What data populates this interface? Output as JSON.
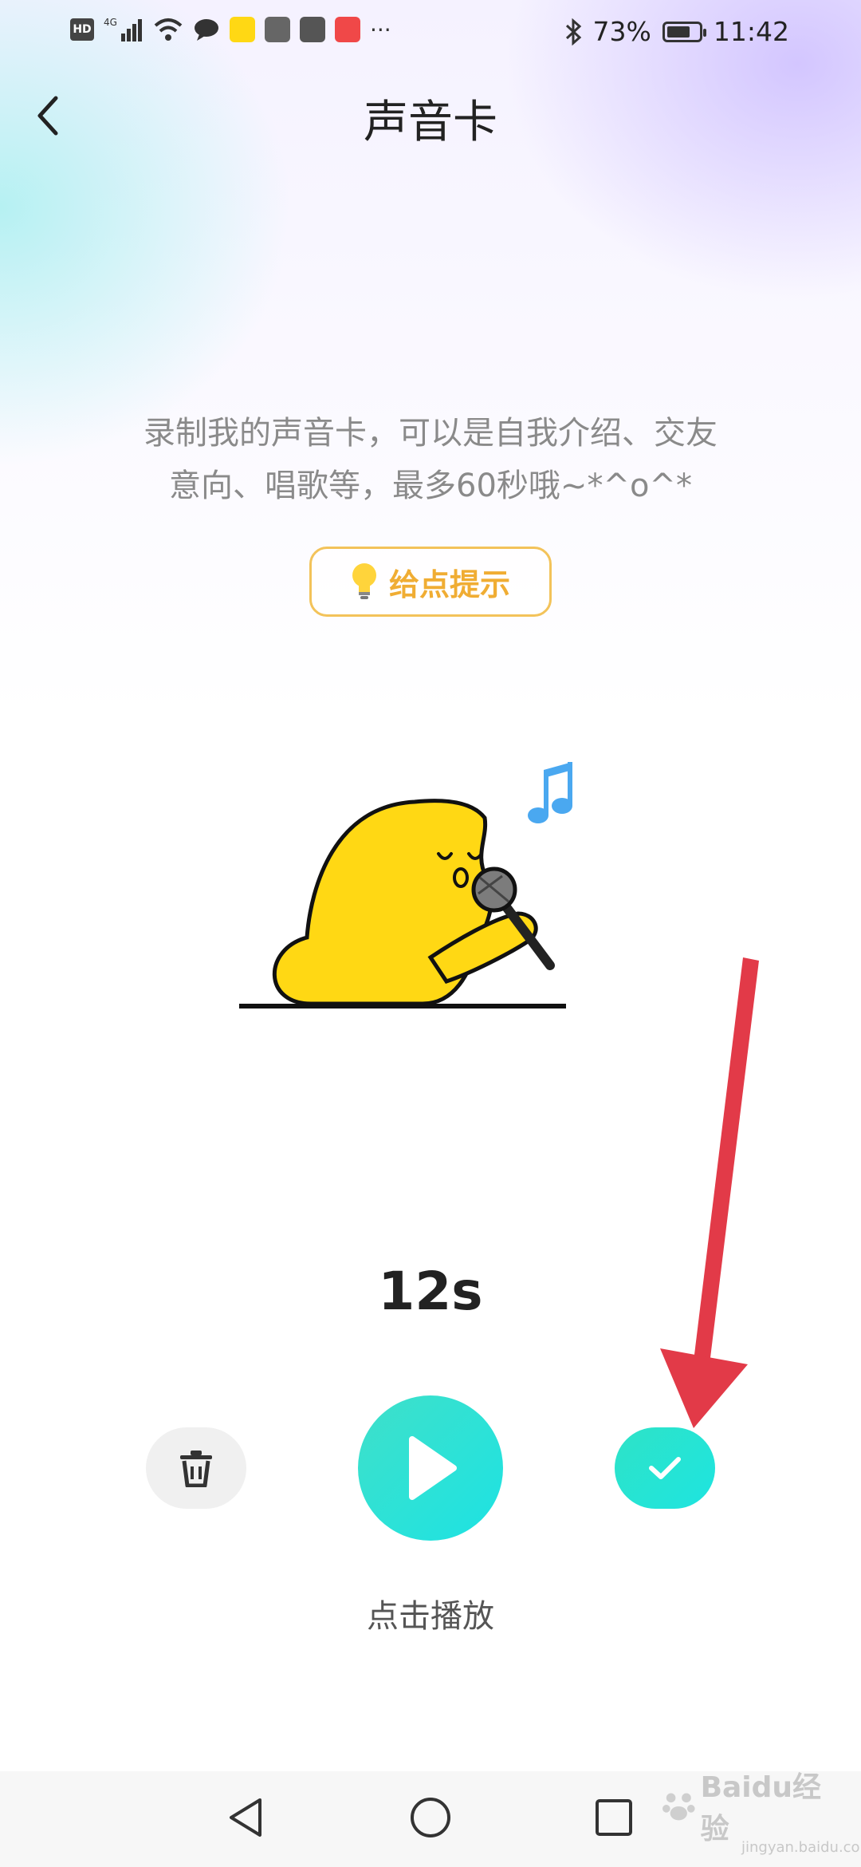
{
  "status_bar": {
    "network": "4G",
    "battery_percent": "73%",
    "battery_level": 0.73,
    "time": "11:42",
    "more_indicator": "···"
  },
  "header": {
    "title": "声音卡"
  },
  "description": {
    "line1": "录制我的声音卡，可以是自我介绍、交友",
    "line2": "意向、唱歌等，最多60秒哦~*^o^*"
  },
  "hint_button": {
    "label": "给点提示"
  },
  "recording": {
    "duration": "12s"
  },
  "controls": {
    "play_hint": "点击播放"
  },
  "watermark": {
    "brand": "Baidu经验",
    "url": "jingyan.baidu.com"
  },
  "colors": {
    "accent": "#1de3d6",
    "hint_border": "#f3c35a",
    "hint_text": "#f0ad33",
    "annotation_arrow": "#e23a48",
    "mascot": "#ffd814"
  },
  "icons": {
    "back": "back-arrow-icon",
    "hint": "lightbulb-icon",
    "delete": "trash-icon",
    "play": "play-icon",
    "confirm": "check-icon"
  }
}
